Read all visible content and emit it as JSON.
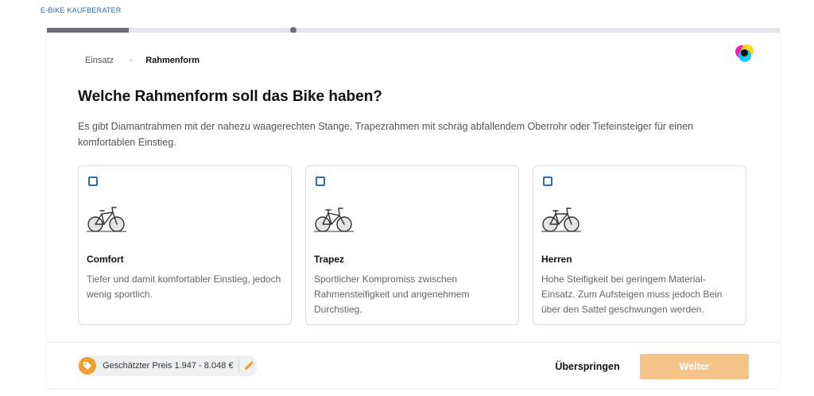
{
  "app": {
    "title": "E-BIKE KAUFBERATER"
  },
  "progress": {
    "fill_fraction": 0.112,
    "marker_fraction": 0.336
  },
  "breadcrumb": {
    "items": [
      "Einsatz",
      "Rahmenform"
    ],
    "separator": "•"
  },
  "question": {
    "title": "Welche Rahmenform soll das Bike haben?",
    "description": "Es gibt Diamantrahmen mit der nahezu waagerechten Stange, Trapezrahmen mit schräg abfallendem Oberrohr oder Tiefeinsteiger für einen komfortablen Einstieg."
  },
  "options": [
    {
      "title": "Comfort",
      "description": "Tiefer und damit komfortabler Einstieg, jedoch wenig sportlich.",
      "icon": "comfort-bike-icon",
      "checked": false
    },
    {
      "title": "Trapez",
      "description": "Sportlicher Kompromiss zwischen Rahmensteifigkeit und angenehmem Durchstieg.",
      "icon": "trapez-bike-icon",
      "checked": false
    },
    {
      "title": "Herren",
      "description": "Hohe Steifigkeit bei geringem Material-Einsatz. Zum Aufsteigen muss jedoch Bein über den Sattel geschwungen werden.",
      "icon": "herren-bike-icon",
      "checked": false
    }
  ],
  "footer": {
    "price_label": "Geschätzter Preis 1.947 - 8.048 €",
    "skip_label": "Überspringen",
    "next_label": "Weiter"
  },
  "colors": {
    "accent": "#2b6fa6",
    "progress": "#6c6f73",
    "next_button": "#f6c48a",
    "price_tag": "#f0a030",
    "edit_pencil": "#e89a2c"
  }
}
